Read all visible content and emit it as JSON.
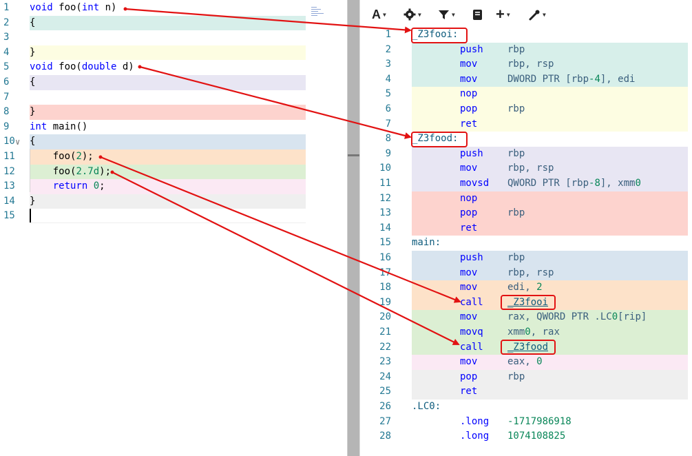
{
  "source": {
    "lines": [
      {
        "n": "1",
        "text": "void foo(int n)"
      },
      {
        "n": "2",
        "text": "{"
      },
      {
        "n": "3",
        "text": ""
      },
      {
        "n": "4",
        "text": "}"
      },
      {
        "n": "5",
        "text": "void foo(double d)"
      },
      {
        "n": "6",
        "text": "{"
      },
      {
        "n": "7",
        "text": ""
      },
      {
        "n": "8",
        "text": "}"
      },
      {
        "n": "9",
        "text": "int main()"
      },
      {
        "n": "10",
        "text": "{"
      },
      {
        "n": "11",
        "text": "    foo(2);"
      },
      {
        "n": "12",
        "text": "    foo(2.7d);"
      },
      {
        "n": "13",
        "text": "    return 0;"
      },
      {
        "n": "14",
        "text": "}"
      },
      {
        "n": "15",
        "text": ""
      }
    ]
  },
  "toolbar": {
    "font_icon": "A",
    "settings_icon": "gear-icon",
    "filter_icon": "filter-icon",
    "libraries_icon": "book-icon",
    "add_icon": "+",
    "tools_icon": "wrench-icon"
  },
  "asm": {
    "lines": [
      {
        "n": "1",
        "label": "_Z3fooi:"
      },
      {
        "n": "2",
        "m": "push",
        "o": "rbp"
      },
      {
        "n": "3",
        "m": "mov",
        "o": "rbp, rsp"
      },
      {
        "n": "4",
        "m": "mov",
        "o": "DWORD PTR [rbp-4], edi"
      },
      {
        "n": "5",
        "m": "nop",
        "o": ""
      },
      {
        "n": "6",
        "m": "pop",
        "o": "rbp"
      },
      {
        "n": "7",
        "m": "ret",
        "o": ""
      },
      {
        "n": "8",
        "label": "_Z3food:"
      },
      {
        "n": "9",
        "m": "push",
        "o": "rbp"
      },
      {
        "n": "10",
        "m": "mov",
        "o": "rbp, rsp"
      },
      {
        "n": "11",
        "m": "movsd",
        "o": "QWORD PTR [rbp-8], xmm0"
      },
      {
        "n": "12",
        "m": "nop",
        "o": ""
      },
      {
        "n": "13",
        "m": "pop",
        "o": "rbp"
      },
      {
        "n": "14",
        "m": "ret",
        "o": ""
      },
      {
        "n": "15",
        "label": "main:"
      },
      {
        "n": "16",
        "m": "push",
        "o": "rbp"
      },
      {
        "n": "17",
        "m": "mov",
        "o": "rbp, rsp"
      },
      {
        "n": "18",
        "m": "mov",
        "o": "edi, 2"
      },
      {
        "n": "19",
        "m": "call",
        "o": "_Z3fooi"
      },
      {
        "n": "20",
        "m": "mov",
        "o": "rax, QWORD PTR .LC0[rip]"
      },
      {
        "n": "21",
        "m": "movq",
        "o": "xmm0, rax"
      },
      {
        "n": "22",
        "m": "call",
        "o": "_Z3food"
      },
      {
        "n": "23",
        "m": "mov",
        "o": "eax, 0"
      },
      {
        "n": "24",
        "m": "pop",
        "o": "rbp"
      },
      {
        "n": "25",
        "m": "ret",
        "o": ""
      },
      {
        "n": "26",
        "label": ".LC0:"
      },
      {
        "n": "27",
        "m": ".long",
        "o": "-1717986918"
      },
      {
        "n": "28",
        "m": ".long",
        "o": "1074108825"
      }
    ]
  },
  "colors": {
    "teal": "#d7efea",
    "yellow": "#fdfde2",
    "lavender": "#e8e6f3",
    "pink": "#fdd3ce",
    "blue": "#d8e4ef",
    "orange": "#fde2c9",
    "green": "#dcefd3",
    "light_pink": "#fbe9f4",
    "gray": "#efefef",
    "annotation": "#e21212"
  }
}
